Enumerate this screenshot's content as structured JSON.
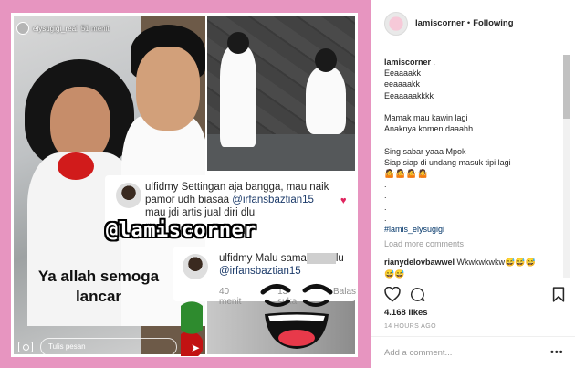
{
  "story": {
    "username": "elysugigi_real",
    "time": "51 menit",
    "reply_placeholder": "Tulis pesan"
  },
  "comment_card_1": {
    "user": "ulfidmy",
    "text_a": " Settingan aja bangga, mau naik pamor udh biasaa ",
    "mention": "@irfansbaztian15",
    "text_b": " mau jdi artis jual diri dlu"
  },
  "comment_card_2": {
    "user": "ulfidmy",
    "text_a": " Malu sama",
    "text_b": "lu ",
    "mention": "@irfansbaztian15",
    "time": "40 menit",
    "likes": "13 suka",
    "reply": "Balas"
  },
  "watermark": "@lamiscorner",
  "overlay_caption": "Ya allah semoga lancar",
  "post": {
    "username": "lamiscorner",
    "separator": "•",
    "follow_status": "Following",
    "caption_user": "lamiscorner",
    "caption_lines": [
      ".",
      "Eeaaaakk",
      "eeaaaakk",
      "Eeaaaaakkkk",
      "",
      "Mamak mau kawin lagi",
      "Anaknya komen daaahh",
      "",
      "Sing sabar yaaa Mpok",
      "Siap siap di undang masuk tipi lagi"
    ],
    "emoji_row": "🤷🤷🤷🤷",
    "dot_lines": [
      ".",
      ".",
      ".",
      "."
    ],
    "hashtag": "#lamis_elysugigi",
    "load_more": "Load more comments",
    "reply_user": "rianydelovbawwel",
    "reply_text": "Wkwkwkwkw😅😅😅",
    "reply_text_2": "😅😅",
    "likes": "4.168 likes",
    "timestamp": "14 HOURS AGO",
    "add_comment": "Add a comment..."
  },
  "icons": {
    "like": "heart-icon",
    "comment": "comment-icon",
    "save": "bookmark-icon",
    "more": "more-icon",
    "camera": "camera-icon",
    "send": "send-icon"
  },
  "colors": {
    "media_border": "#e795c0",
    "link": "#003569",
    "muted": "#999999"
  }
}
